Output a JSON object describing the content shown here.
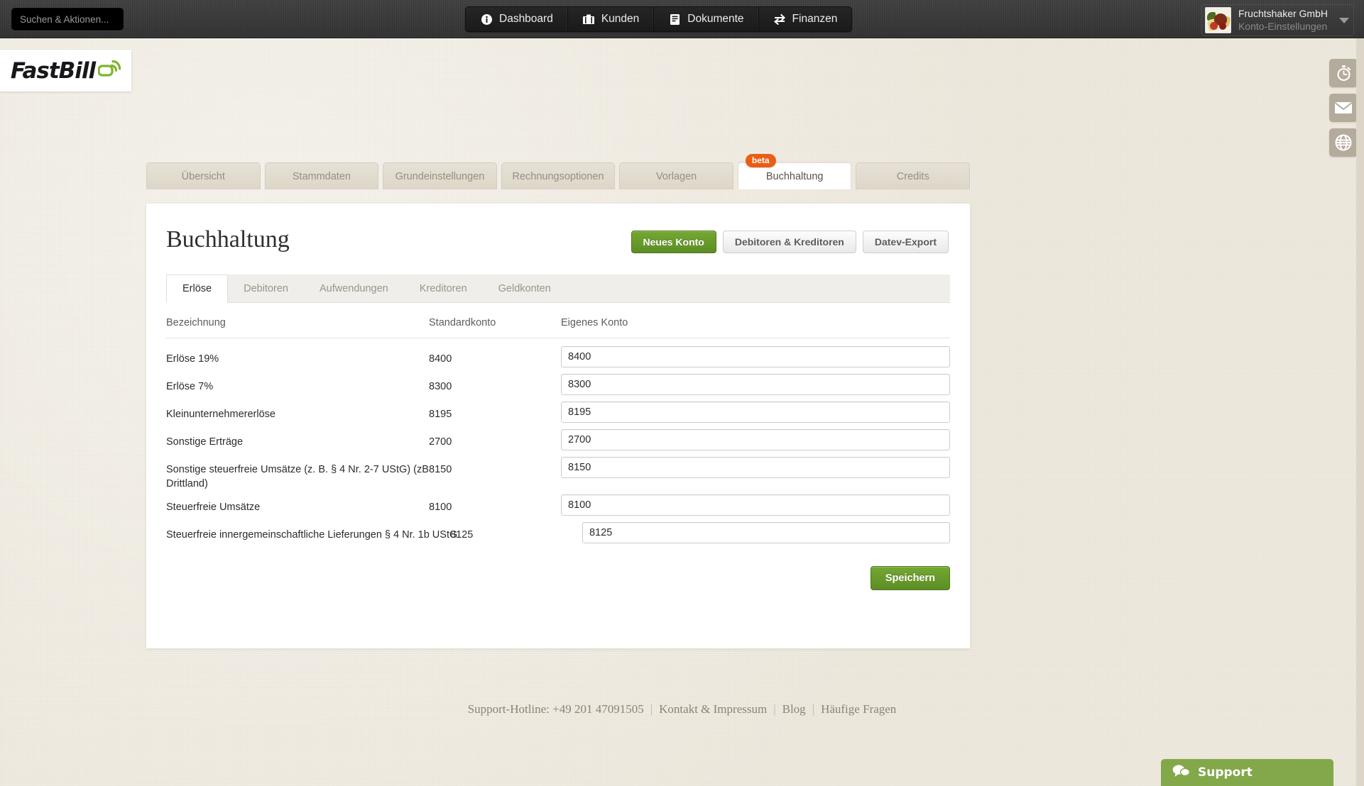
{
  "topbar": {
    "search": {
      "placeholder": "Suchen & Aktionen...",
      "value": ""
    },
    "nav": [
      {
        "label": "Dashboard",
        "icon": "info-icon"
      },
      {
        "label": "Kunden",
        "icon": "briefcase-icon"
      },
      {
        "label": "Dokumente",
        "icon": "document-icon"
      },
      {
        "label": "Finanzen",
        "icon": "transfer-icon"
      }
    ],
    "account": {
      "name": "Fruchtshaker GmbH",
      "subtitle": "Konto-Einstellungen",
      "avatar_icon": "fruit-bowl-avatar",
      "caret_icon": "chevron-down-icon"
    }
  },
  "brand": {
    "name": "FastBill",
    "mark_icon": "fastbill-signal-icon",
    "accent": "#7db52b"
  },
  "rail": [
    {
      "icon": "stopwatch-icon",
      "name": "timetracking"
    },
    {
      "icon": "envelope-icon",
      "name": "messages"
    },
    {
      "icon": "globe-icon",
      "name": "language"
    }
  ],
  "outer_tabs": [
    {
      "label": "Übersicht",
      "active": false
    },
    {
      "label": "Stammdaten",
      "active": false
    },
    {
      "label": "Grundeinstellungen",
      "active": false
    },
    {
      "label": "Rechnungsoptionen",
      "active": false
    },
    {
      "label": "Vorlagen",
      "active": false
    },
    {
      "label": "Buchhaltung",
      "active": true,
      "badge": "beta"
    },
    {
      "label": "Credits",
      "active": false
    }
  ],
  "page": {
    "title": "Buchhaltung",
    "actions": [
      {
        "label": "Neues Konto",
        "style": "green"
      },
      {
        "label": "Debitoren & Kreditoren",
        "style": "grey"
      },
      {
        "label": "Datev-Export",
        "style": "grey"
      }
    ],
    "save_label": "Speichern"
  },
  "inner_tabs": [
    {
      "label": "Erlöse",
      "active": true
    },
    {
      "label": "Debitoren",
      "active": false
    },
    {
      "label": "Aufwendungen",
      "active": false
    },
    {
      "label": "Kreditoren",
      "active": false
    },
    {
      "label": "Geldkonten",
      "active": false
    }
  ],
  "table": {
    "headers": [
      "Bezeichnung",
      "Standardkonto",
      "Eigenes Konto"
    ],
    "rows": [
      {
        "bezeichnung": "Erlöse 19%",
        "standardkonto": "8400",
        "eigenes_konto": "8400",
        "wide": false
      },
      {
        "bezeichnung": "Erlöse 7%",
        "standardkonto": "8300",
        "eigenes_konto": "8300",
        "wide": false
      },
      {
        "bezeichnung": "Kleinunternehmererlöse",
        "standardkonto": "8195",
        "eigenes_konto": "8195",
        "wide": false
      },
      {
        "bezeichnung": "Sonstige Erträge",
        "standardkonto": "2700",
        "eigenes_konto": "2700",
        "wide": false
      },
      {
        "bezeichnung": "Sonstige steuerfreie Umsätze (z. B. § 4 Nr. 2-7 UStG) (zB Drittland)",
        "standardkonto": "8150",
        "eigenes_konto": "8150",
        "wide": false
      },
      {
        "bezeichnung": "Steuerfreie Umsätze",
        "standardkonto": "8100",
        "eigenes_konto": "8100",
        "wide": false
      },
      {
        "bezeichnung": "Steuerfreie innergemeinschaftliche Lieferungen § 4 Nr. 1b UStG",
        "standardkonto": "8125",
        "eigenes_konto": "8125",
        "wide": true
      }
    ]
  },
  "footer": {
    "hotline": "Support-Hotline: +49 201 47091505",
    "links": [
      "Kontakt & Impressum",
      "Blog",
      "Häufige Fragen"
    ]
  },
  "support_widget": {
    "label": "Support",
    "icon": "chat-bubble-icon",
    "color": "#82a84a"
  }
}
